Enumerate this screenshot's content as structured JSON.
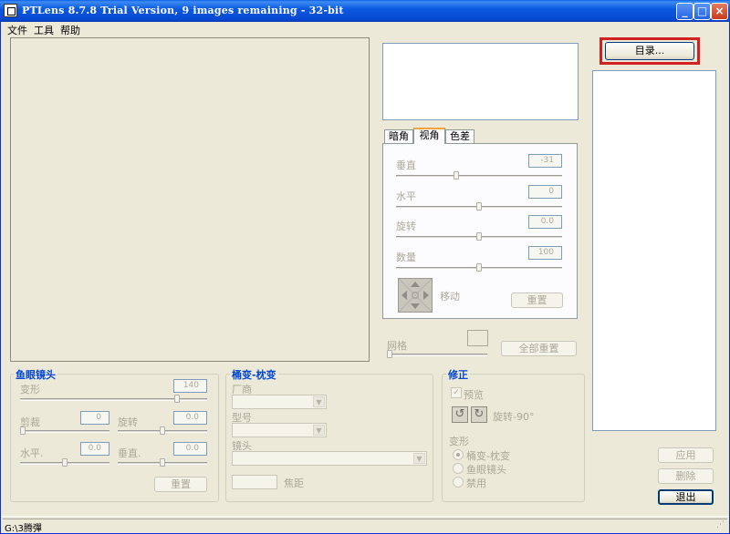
{
  "window": {
    "title": "PTLens 8.7.8 Trial Version, 9 images remaining - 32-bit"
  },
  "menu": [
    "文件",
    "工具",
    "帮助"
  ],
  "buttons": {
    "directory": "目录...",
    "reset_all": "全部重置",
    "apply": "应用",
    "delete": "删除",
    "exit": "退出"
  },
  "perspective": {
    "tabs": [
      "暗角",
      "视角",
      "色差"
    ],
    "active_tab": "视角",
    "vertical": {
      "label": "垂直",
      "value": "-31",
      "level": 0.36
    },
    "horizontal": {
      "label": "水平",
      "value": "0",
      "level": 0.5
    },
    "rotate": {
      "label": "旋转",
      "value": "0.0",
      "level": 0.5
    },
    "amount": {
      "label": "数量",
      "value": "100",
      "level": 0.5
    },
    "move_label": "移动",
    "reset": "重置"
  },
  "grid": {
    "label": "网格"
  },
  "fisheye": {
    "title": "鱼眼镜头",
    "distort": {
      "label": "变形",
      "value": "140",
      "level": 0.85
    },
    "crop": {
      "label": "剪裁",
      "value": "0"
    },
    "rotate": {
      "label": "旋转",
      "value": "0.0"
    },
    "horizontal": {
      "label": "水平.",
      "value": "0.0"
    },
    "vertical": {
      "label": "垂直.",
      "value": "0.0"
    },
    "reset": "重置"
  },
  "barrel": {
    "title": "桶变-枕变",
    "maker_label": "厂商",
    "model_label": "型号",
    "lens_label": "镜头",
    "focal_label": "焦距"
  },
  "correct": {
    "title": "修正",
    "preview_label": "预览",
    "rotate_label": "旋转-90°",
    "distort_label": "变形",
    "options": [
      "桶变-枕变",
      "鱼眼镜头",
      "禁用"
    ]
  },
  "status": {
    "text": "G:\\3腾彈"
  }
}
